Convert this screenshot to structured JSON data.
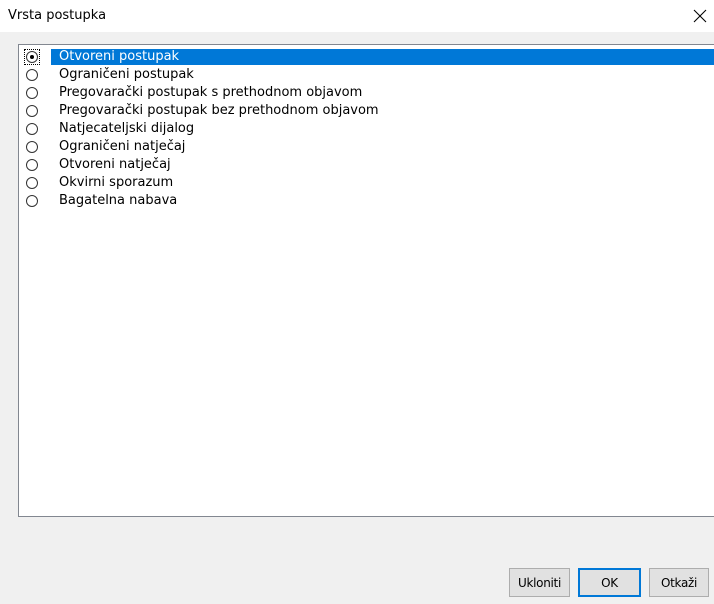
{
  "window": {
    "title": "Vrsta postupka",
    "close_icon": "close-icon"
  },
  "list": {
    "selected_index": 0,
    "items": [
      {
        "label": "Otvoreni postupak",
        "checked": true
      },
      {
        "label": "Ograničeni postupak",
        "checked": false
      },
      {
        "label": "Pregovarački postupak s prethodnom objavom",
        "checked": false
      },
      {
        "label": "Pregovarački postupak bez prethodnom objavom",
        "checked": false
      },
      {
        "label": "Natjecateljski dijalog",
        "checked": false
      },
      {
        "label": "Ograničeni natječaj",
        "checked": false
      },
      {
        "label": "Otvoreni natječaj",
        "checked": false
      },
      {
        "label": "Okvirni sporazum",
        "checked": false
      },
      {
        "label": "Bagatelna nabava",
        "checked": false
      }
    ]
  },
  "buttons": {
    "remove_label": "Ukloniti",
    "ok_label": "OK",
    "cancel_label": "Otkaži"
  },
  "colors": {
    "selection": "#0078d7",
    "window_bg": "#f0f0f0",
    "list_bg": "#ffffff"
  }
}
